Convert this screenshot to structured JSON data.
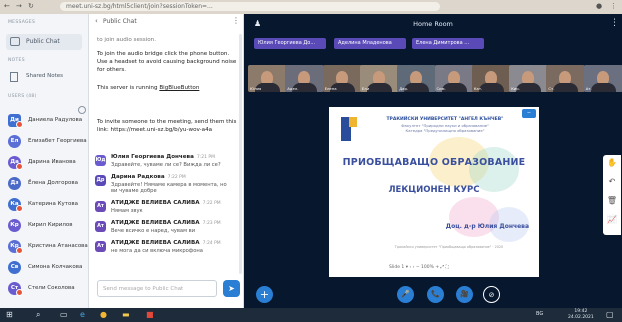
{
  "browser": {
    "url": "meet.uni-sz.bg/html5client/join?sessionToken=..."
  },
  "sidebar": {
    "messages_label": "MESSAGES",
    "public_chat": "Public Chat",
    "notes_label": "NOTES",
    "shared_notes": "Shared Notes",
    "users_label": "USERS (48)",
    "users": [
      {
        "initials": "Ди",
        "name": "Даниела Радулова",
        "color": "#3f6fd0",
        "presenter": true
      },
      {
        "initials": "Ел",
        "name": "Елизабет Георгиева",
        "color": "#5a6fd6"
      },
      {
        "initials": "Да",
        "name": "Дарина Иванова",
        "color": "#6a5bd0"
      },
      {
        "initials": "Дз",
        "name": "Ёлена Долгорова",
        "color": "#4b69c9"
      },
      {
        "initials": "Ка",
        "name": "Катерина Кутова",
        "color": "#3f6fd0"
      },
      {
        "initials": "Кр",
        "name": "Кирил Кирилов",
        "color": "#6a5bd0"
      },
      {
        "initials": "Кр",
        "name": "Кристина Атанасова",
        "color": "#5a6fd6"
      },
      {
        "initials": "Св",
        "name": "Симона Колчакова",
        "color": "#3f6fd0"
      },
      {
        "initials": "Ст",
        "name": "Стели Соколова",
        "color": "#6a5bd0"
      }
    ]
  },
  "chat": {
    "title": "Public Chat",
    "sys1": "to join audio session.",
    "sys2": "To join the audio bridge click the phone button. Use a headset to avoid causing background noise for others.",
    "sys3_prefix": "This server is running ",
    "sys3_link": "BigBlueButton",
    "sys4": "To invite someone to the meeting, send them this link: https://meet.uni-sz.bg/b/yu-wov-a4a",
    "messages": [
      {
        "initials": "Юд",
        "name": "Юлия Георгиева Дончева",
        "time": "7:21 PM",
        "text": "Здравейте, чуваме ли се? Вижда ли се?",
        "color": "#6a5bd0"
      },
      {
        "initials": "Др",
        "name": "Дарина Радкова",
        "time": "7:22 PM",
        "text": "Здравейте! Нямаме камера в момента, но",
        "text2": "ви чуваме добре",
        "color": "#5a4ab8"
      },
      {
        "initials": "Ат",
        "name": "АТИДЖЕ ВЕЛИЕВА САЛИВА",
        "time": "7:22 PM",
        "text": "Нямам звук",
        "color": "#6a4bb8"
      },
      {
        "initials": "Ат",
        "name": "АТИДЖЕ ВЕЛИЕВА САЛИВА",
        "time": "7:23 PM",
        "text": "Вече всичко е наред, чувам ви",
        "color": "#6a4bb8"
      },
      {
        "initials": "Ат",
        "name": "АТИДЖЕ ВЕЛИЕВА САЛИВА",
        "time": "7:24 PM",
        "text": "не мога да си включа микрофона",
        "color": "#6a4bb8"
      }
    ],
    "input_placeholder": "Send message to Public Chat",
    "send": "➤"
  },
  "main": {
    "room_title": "Home Room",
    "talkers": [
      "Юлия Георгиева До...",
      "Аделина Младенова",
      "Елена Димитрова ..."
    ],
    "tiles": [
      "Юлия",
      "Адел.",
      "Елена",
      "Ели",
      "Дар.",
      "Сим.",
      "Кат.",
      "Кир.",
      "Ст.",
      "Ат."
    ],
    "tile_colors": [
      "#8c7a6a",
      "#6b6e7a",
      "#7a6a5e",
      "#9a8c7a",
      "#5e6a78",
      "#7a7a86",
      "#6e5e52",
      "#8a8a90",
      "#7a6a60",
      "#6a7080"
    ]
  },
  "slide": {
    "university": "ТРАКИЙСКИ УНИВЕРСИТЕТ \"АНГЕЛ КЪНЧЕВ\"",
    "faculty": "Факултет \"Природни науки и образование\"",
    "dept": "Катедра \"Предучилищно образование\"",
    "title1": "ПРИОБЩАВАЩО ОБРАЗОВАНИЕ",
    "title2": "ЛЕКЦИОНЕН КУРС",
    "author": "Доц. д-р Юлия Дончева",
    "footer": "Тракийски университет \"Приобщаващо образование\" · 2020",
    "controls": "Slide 1 ▾   ‹   ›   −  100%  +   ⤢   ⛶",
    "minimize": "−"
  },
  "toolbar": {
    "hand": "✋",
    "undo": "↶",
    "trash": "🗑",
    "chart": "📈"
  },
  "controls": {
    "add": "+",
    "mic": "🎤",
    "phone": "📞",
    "camera": "🎥",
    "share": "⊘"
  },
  "taskbar": {
    "lang": "BG",
    "time": "19:42",
    "date": "24.02.2021"
  },
  "colors": {
    "main_bg": "#06172e",
    "accent": "#2a7fd4",
    "talker": "#5a4ab8"
  }
}
